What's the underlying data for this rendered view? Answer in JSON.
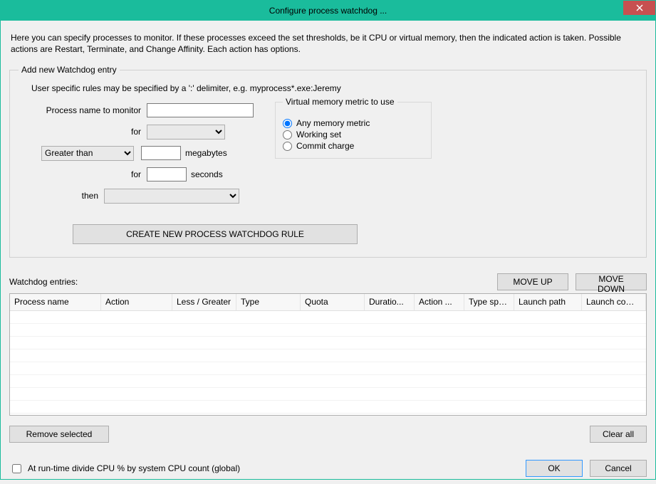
{
  "window": {
    "title": "Configure process watchdog ..."
  },
  "description": "Here you can specify processes to monitor. If these processes exceed the set thresholds, be it CPU or virtual memory, then the indicated action is taken. Possible actions are Restart, Terminate, and Change Affinity. Each action has options.",
  "group": {
    "legend": "Add new Watchdog entry",
    "hint": "User specific rules may be specified by a ':' delimiter, e.g. myprocess*.exe:Jeremy",
    "labels": {
      "process_name": "Process name to monitor",
      "for1": "for",
      "megabytes": "megabytes",
      "for2": "for",
      "seconds": "seconds",
      "then": "then"
    },
    "values": {
      "process_name": "",
      "for1": "",
      "comparison": "Greater than",
      "mb": "",
      "for2": "",
      "then": ""
    },
    "metric": {
      "title": "Virtual memory metric to use",
      "options": {
        "any": "Any memory metric",
        "ws": "Working set",
        "cc": "Commit charge"
      },
      "selected": "any"
    },
    "create_button": "CREATE NEW PROCESS WATCHDOG RULE"
  },
  "list": {
    "label": "Watchdog entries:",
    "move_up": "MOVE UP",
    "move_down": "MOVE DOWN",
    "columns": {
      "c0": "Process name",
      "c1": "Action",
      "c2": "Less / Greater",
      "c3": "Type",
      "c4": "Quota",
      "c5": "Duratio...",
      "c6": "Action ...",
      "c7": "Type spe...",
      "c8": "Launch path",
      "c9": "Launch comma..."
    },
    "remove": "Remove selected",
    "clear": "Clear all"
  },
  "footer": {
    "checkbox_label": "At run-time divide CPU % by system CPU count (global)",
    "ok": "OK",
    "cancel": "Cancel"
  }
}
